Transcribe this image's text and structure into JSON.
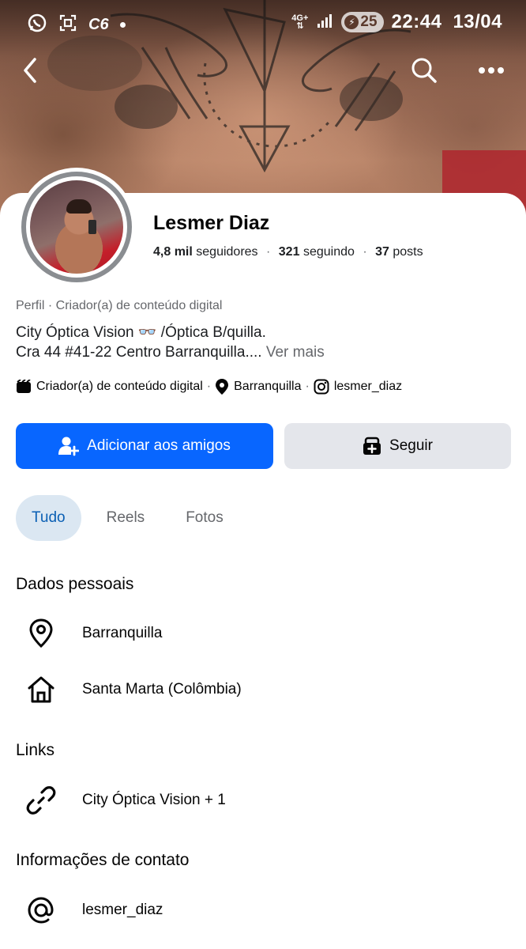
{
  "status_bar": {
    "carrier_tag": "C6",
    "network": "4G+",
    "battery": "25",
    "time": "22:44",
    "date": "13/04"
  },
  "profile": {
    "name": "Lesmer Diaz",
    "followers_count": "4,8 mil",
    "followers_label": "seguidores",
    "following_count": "321",
    "following_label": "seguindo",
    "posts_count": "37",
    "posts_label": "posts",
    "category_line": "Perfil · Criador(a) de conteúdo digital",
    "bio_line1": "City Óptica Vision 👓 /Óptica B/quilla.",
    "bio_line2": "Cra 44 #41-22 Centro Barranquilla....",
    "bio_more": "Ver mais",
    "meta": {
      "creator": "Criador(a) de conteúdo digital",
      "location": "Barranquilla",
      "instagram": "lesmer_diaz"
    }
  },
  "actions": {
    "add_friend": "Adicionar aos amigos",
    "follow": "Seguir"
  },
  "tabs": [
    {
      "label": "Tudo",
      "active": true
    },
    {
      "label": "Reels",
      "active": false
    },
    {
      "label": "Fotos",
      "active": false
    }
  ],
  "sections": {
    "personal": {
      "title": "Dados pessoais",
      "items": [
        {
          "icon": "location-pin-icon",
          "text": "Barranquilla"
        },
        {
          "icon": "home-icon",
          "text": "Santa Marta (Colômbia)"
        }
      ]
    },
    "links": {
      "title": "Links",
      "items": [
        {
          "icon": "link-icon",
          "text": "City Óptica Vision + 1"
        }
      ]
    },
    "contact": {
      "title": "Informações de contato",
      "items": [
        {
          "icon": "at-icon",
          "text": "lesmer_diaz"
        }
      ]
    }
  },
  "colors": {
    "primary": "#0866ff",
    "secondary_button": "#e4e6eb",
    "active_tab_bg": "#dbe7f2",
    "active_tab_text": "#0a5fb4",
    "muted_text": "#65676b"
  }
}
